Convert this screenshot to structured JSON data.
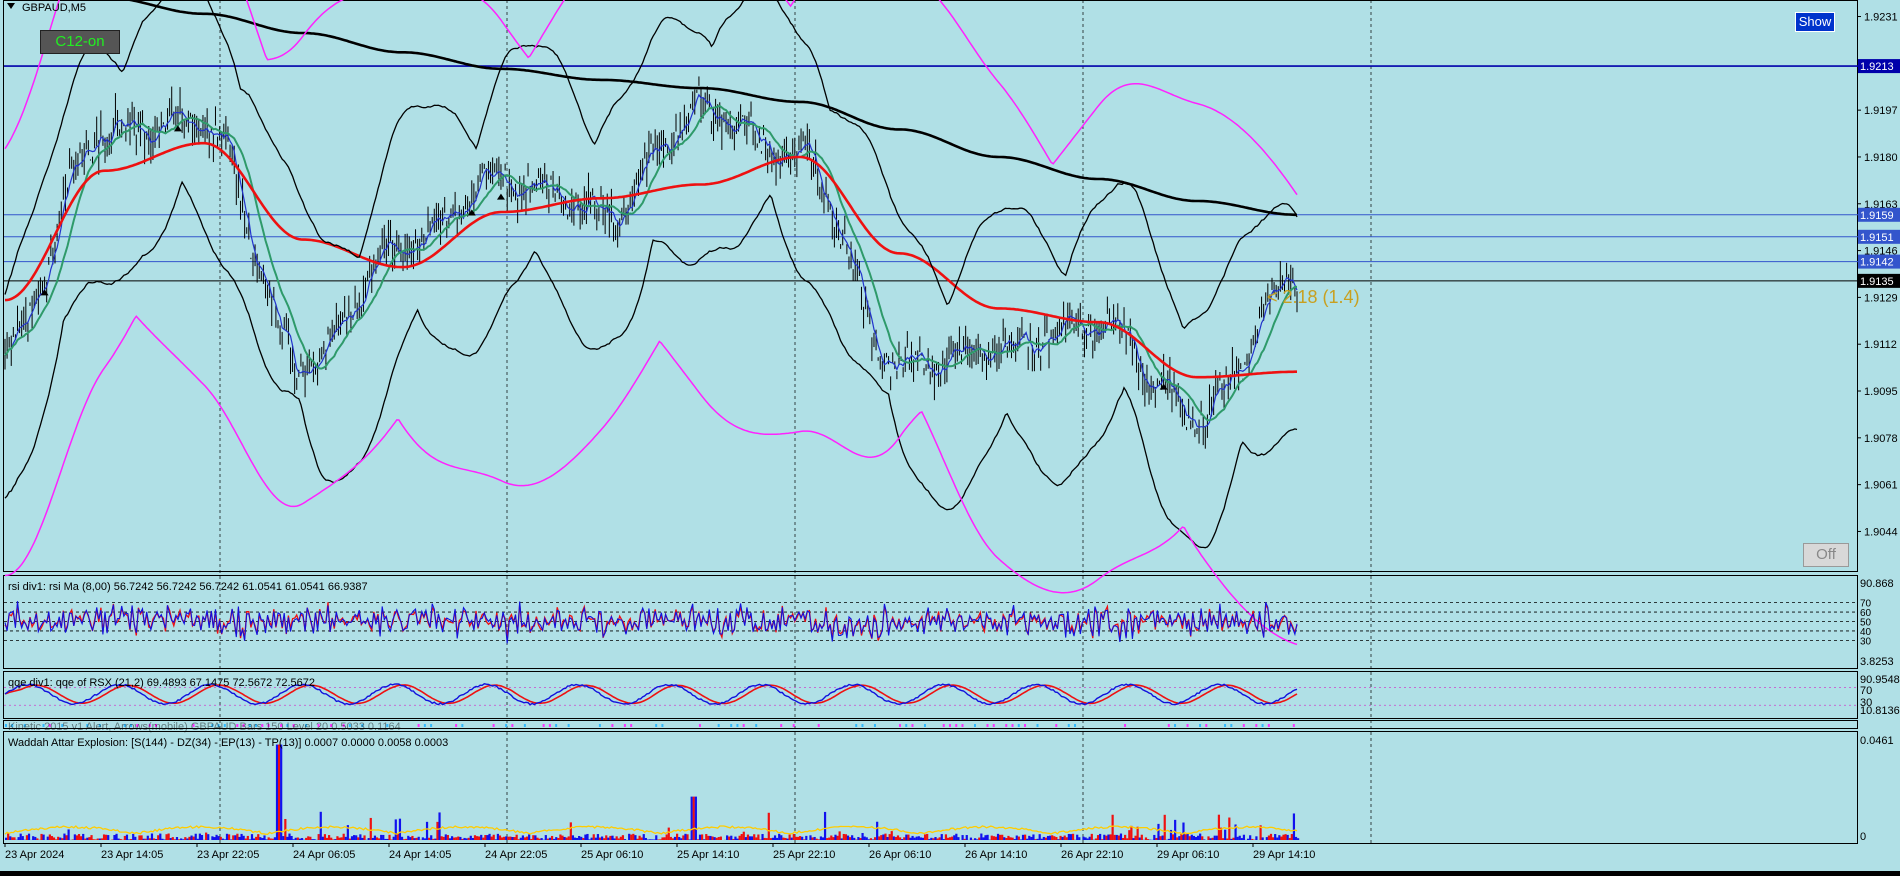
{
  "symbol": "GBPAUD,M5",
  "buttons": {
    "show": "Show",
    "c12": "C12-on",
    "off": "Off"
  },
  "price_axis": {
    "ticks": [
      "1.9231",
      "1.9197",
      "1.9180",
      "1.9163",
      "1.9146",
      "1.9129",
      "1.9112",
      "1.9095",
      "1.9078",
      "1.9061",
      "1.9044"
    ],
    "level_labels": [
      {
        "value": "1.9213",
        "color": "#0000aa"
      },
      {
        "value": "1.9159",
        "color": "#3355cc"
      },
      {
        "value": "1.9151",
        "color": "#3355cc"
      },
      {
        "value": "1.9142",
        "color": "#3355cc"
      },
      {
        "value": "1.9135",
        "color": "#000000"
      }
    ]
  },
  "time_axis": [
    "23 Apr 2024",
    "23 Apr 14:05",
    "23 Apr 22:05",
    "24 Apr 06:05",
    "24 Apr 14:05",
    "24 Apr 22:05",
    "25 Apr 06:10",
    "25 Apr 14:10",
    "25 Apr 22:10",
    "26 Apr 06:10",
    "26 Apr 14:10",
    "26 Apr 22:10",
    "29 Apr 06:10",
    "29 Apr 14:10"
  ],
  "annotation": "< 2.18 (1.4)",
  "panels": {
    "rsi": {
      "label": "rsi div1: rsi Ma (8,00) 56.7242 56.7242 56.7242 61.0541 61.0541 66.9387",
      "axis_top": "90.868",
      "axis_bottom": "3.8253",
      "levels": [
        "70",
        "60",
        "50",
        "40",
        "30"
      ]
    },
    "qqe": {
      "label": "qqe div1: qqe of RSX (21,2) 69.4893 67.1475 72.5672 72.5672",
      "axis_top": "90.9548",
      "axis_mid": "70",
      "axis_low": "30",
      "axis_bottom": "10.8136"
    },
    "kinetic": {
      "label": "Kinetic 2015 v1 Alert, Arrows(mobile) GBPAUD Bars 150 Level 20 0.5033 0.1164"
    },
    "waddah": {
      "label": "Waddah Attar Explosion: [S(144) - DZ(34) - EP(13) - TP(13)] 0.0007 0.0000 0.0058 0.0003",
      "axis_top": "0.0461",
      "axis_bottom": "0"
    }
  },
  "chart_data": {
    "type": "line",
    "title": "GBPAUD,M5",
    "ylim": [
      1.903,
      1.9237
    ],
    "price_levels": [
      1.9213,
      1.9159,
      1.9151,
      1.9142,
      1.9135
    ],
    "x": [
      "23 Apr 2024",
      "23 Apr 14:05",
      "23 Apr 22:05",
      "24 Apr 06:05",
      "24 Apr 14:05",
      "24 Apr 22:05",
      "25 Apr 06:10",
      "25 Apr 14:10",
      "25 Apr 22:10",
      "26 Apr 06:10",
      "26 Apr 14:10",
      "26 Apr 22:10",
      "29 Apr 06:10",
      "29 Apr 14:10"
    ],
    "series": [
      {
        "name": "price",
        "values": [
          1.9112,
          1.919,
          1.9192,
          1.9104,
          1.9147,
          1.9172,
          1.916,
          1.9197,
          1.918,
          1.9104,
          1.911,
          1.912,
          1.9086,
          1.9135
        ]
      },
      {
        "name": "ma_red",
        "values": [
          1.9128,
          1.9175,
          1.9185,
          1.915,
          1.914,
          1.916,
          1.9165,
          1.917,
          1.918,
          1.9145,
          1.9125,
          1.912,
          1.91,
          1.9102
        ]
      },
      {
        "name": "ma_long_black",
        "values": [
          1.924,
          1.9238,
          1.9232,
          1.9225,
          1.9218,
          1.9212,
          1.9208,
          1.9205,
          1.92,
          1.919,
          1.918,
          1.9172,
          1.9164,
          1.9159
        ]
      }
    ],
    "colors": {
      "background": "#b0e0e6",
      "price": "#000000",
      "blue_ma": "#2233cc",
      "green_ma": "#2e9a6a",
      "red_ma": "#ee1111",
      "bands_outer": "#ff22ff",
      "bands_inner": "#000000",
      "level_line": "#1133bb",
      "annotation": "#c8a020"
    }
  }
}
